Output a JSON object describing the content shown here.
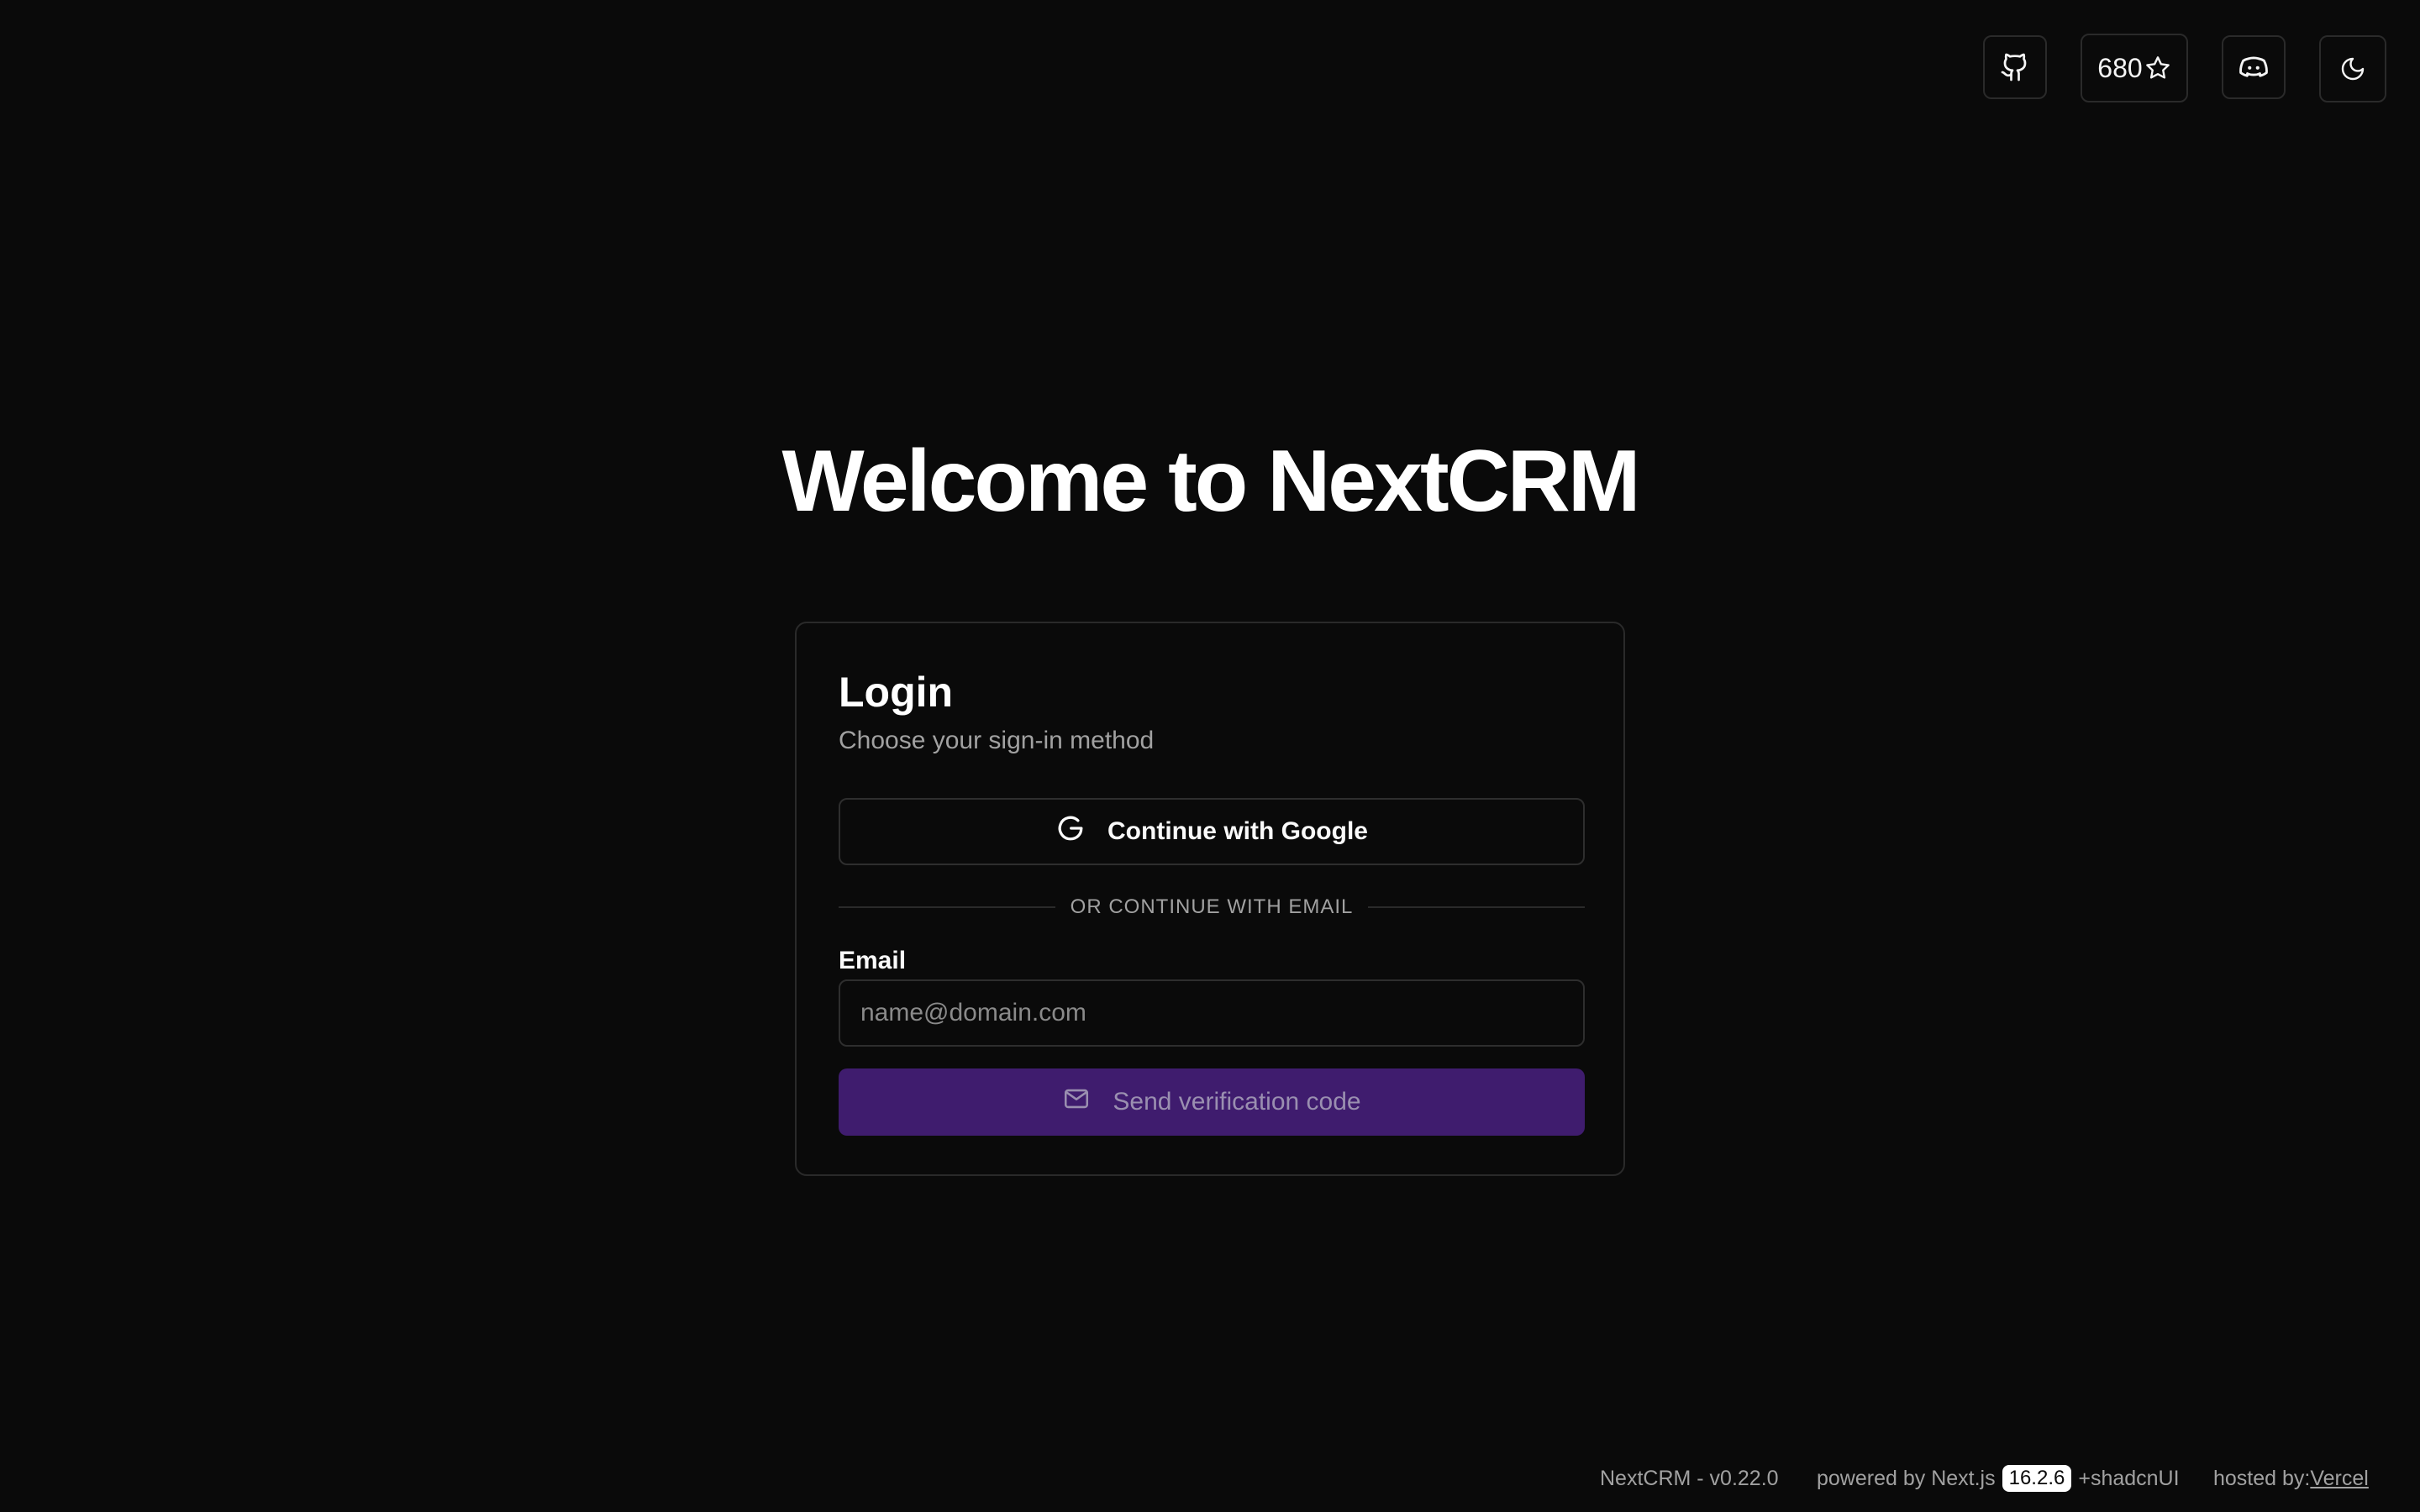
{
  "topbar": {
    "github_icon": "github-icon",
    "stars_count": "680",
    "star_icon": "star-icon",
    "discord_icon": "discord-icon",
    "theme_icon": "moon-icon"
  },
  "hero": {
    "title": "Welcome to NextCRM"
  },
  "login": {
    "title": "Login",
    "subtitle": "Choose your sign-in method",
    "google_label": "Continue with Google",
    "divider_text": "OR CONTINUE WITH EMAIL",
    "email_label": "Email",
    "email_value": "",
    "email_placeholder": "name@domain.com",
    "send_label": "Send verification code",
    "send_button_color": "#3f1c6e"
  },
  "footer": {
    "version": "NextCRM - v0.22.0",
    "powered_prefix": "powered by Next.js",
    "nextjs_version": "16.2.6",
    "powered_suffix": "+shadcnUI",
    "hosted_prefix": "hosted by:",
    "hosted_link": "Vercel"
  },
  "colors": {
    "background": "#0a0a0a",
    "accent": "#3f1c6e",
    "border": "#2a2a2a"
  }
}
